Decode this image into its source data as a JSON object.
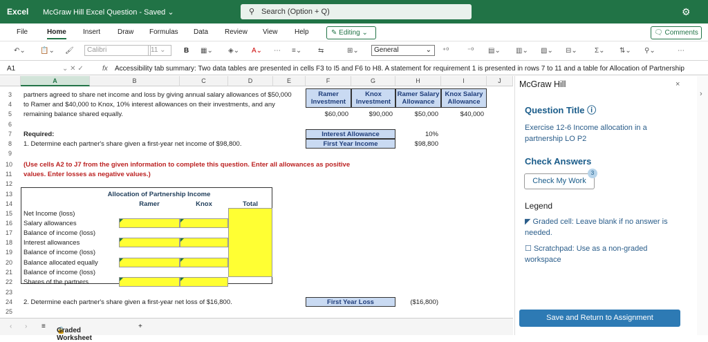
{
  "app": {
    "name": "Excel",
    "doc_title": "McGraw Hill Excel Question",
    "saved_status": "Saved"
  },
  "search": {
    "placeholder": "Search (Option + Q)"
  },
  "menu": [
    "File",
    "Home",
    "Insert",
    "Draw",
    "Formulas",
    "Data",
    "Review",
    "View",
    "Help"
  ],
  "editing_label": "Editing",
  "comments_label": "Comments",
  "toolbar": {
    "font": "Calibri",
    "size": "11",
    "bold": "B",
    "format": "General"
  },
  "formula_bar": {
    "cell_ref": "A1",
    "fx": "fx",
    "content": "Accessibility tab summary: Two data tables are presented in cells F3 to I5 and F6 to H8. A statement for requirement 1 is presented in rows 7 to 11 and a table for Allocation of Partnership"
  },
  "columns": [
    "A",
    "B",
    "C",
    "D",
    "E",
    "F",
    "G",
    "H",
    "I",
    "J"
  ],
  "rows": [
    "3",
    "4",
    "5",
    "6",
    "7",
    "8",
    "9",
    "10",
    "11",
    "12",
    "13",
    "14",
    "15",
    "16",
    "17",
    "18",
    "19",
    "20",
    "21",
    "22",
    "23",
    "24",
    "25"
  ],
  "cells": {
    "intro1": "partners agreed to share net income and loss by giving annual salary allowances of $50,000",
    "intro2": "to Ramer and $40,000 to Knox, 10% interest allowances on their investments, and any",
    "intro3": "remaining balance shared equally.",
    "required": "Required:",
    "req1": "1. Determine each partner's share given a first-year net income of $98,800.",
    "instr1": "(Use cells A2 to J7 from the given information to complete this question. Enter all allowances as positive",
    "instr2": "values. Enter losses as negative values.)",
    "alloc_title": "Allocation of Partnership Income",
    "col_ramer": "Ramer",
    "col_knox": "Knox",
    "col_total": "Total",
    "labels": [
      "Net Income (loss)",
      "Salary allowances",
      "Balance of income (loss)",
      "Interest allowances",
      "Balance of income (loss)",
      "Balance allocated equally",
      "Balance of income (loss)",
      "Shares of the partners"
    ],
    "req2": "2. Determine each partner's share given a first-year net loss of $16,800."
  },
  "table1": {
    "headers": [
      [
        "Ramer",
        "Investment"
      ],
      [
        "Knox",
        "Investment"
      ],
      [
        "Ramer Salary",
        "Allowance"
      ],
      [
        "Knox Salary",
        "Allowance"
      ]
    ],
    "values": [
      "$60,000",
      "$90,000",
      "$50,000",
      "$40,000"
    ]
  },
  "table2": {
    "rows": [
      {
        "label": "Interest Allowance",
        "value": "10%"
      },
      {
        "label": "First Year Income",
        "value": "$98,800"
      }
    ]
  },
  "table3": {
    "label": "First Year Loss",
    "value": "($16,800)"
  },
  "sheet_tab": "Graded Worksheet",
  "panel": {
    "brand": "McGraw Hill",
    "question_title_label": "Question Title",
    "question_title": "Exercise 12-6 Income allocation in a partnership LO P2",
    "check_answers": "Check Answers",
    "check_my_work": "Check My Work",
    "check_count": "3",
    "legend": "Legend",
    "graded_cell": "Graded cell: Leave blank if no answer is needed.",
    "scratchpad": "Scratchpad: Use as a non-graded workspace",
    "save_button": "Save and Return to Assignment"
  }
}
